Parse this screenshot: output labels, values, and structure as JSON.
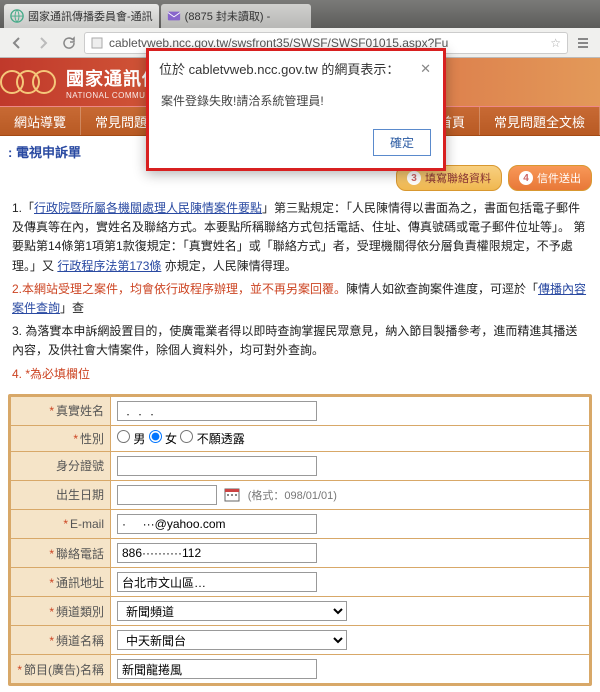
{
  "browser": {
    "tabs": [
      {
        "label": "國家通訊傳播委員會-通訊"
      },
      {
        "label": "(8875 封未讀取) - "
      }
    ],
    "url": "cabletvweb.ncc.gov.tw/swsfront35/SWSF/SWSF01015.aspx?Fu"
  },
  "site": {
    "title_cn": "國家通訊傳",
    "title_en": "NATIONAL COMMUN",
    "nav": [
      "網站導覽",
      "常見問題",
      "首頁",
      "常見問題全文檢"
    ]
  },
  "page": {
    "title": "電視申訴單",
    "steps": [
      {
        "num": "3",
        "label": "填寫聯絡資料"
      },
      {
        "num": "4",
        "label": "信件送出"
      }
    ]
  },
  "instructions": {
    "p1_a": "1.「",
    "p1_link1": "行政院暨所屬各機關處理人民陳情案件要點",
    "p1_b": "」第三點規定：「人民陳情得以書面為之，書面包括電子郵件及傳真等在內，實姓名及聯絡方式。本要點所稱聯絡方式包括電話、住址、傳真號碼或電子郵件位址等」。 第要點第14條第1項第1款復規定：「真實姓名」或「聯絡方式」者，受理機關得依分層負責權限規定，不予處理。」又 ",
    "p1_link2": "行政程序法第173條",
    "p1_c": " 亦規定，人民陳情得理。",
    "p2": "2.本網站受理之案件，均會依行政程序辦理，並不再另案回覆。",
    "p2_b": "陳情人如欲查詢案件進度，可逕於「",
    "p2_link": "傳播內容案件查詢",
    "p2_c": "」查",
    "p3": "3. 為落實本申訴網設置目的，使廣電業者得以即時查詢掌握民眾意見，納入節目製播參考，進而精進其播送內容，及供社會大情案件，除個人資料外，均可對外查詢。",
    "p4": "4. *為必填欄位"
  },
  "form": {
    "labels": {
      "name": "真實姓名",
      "gender": "性別",
      "gender_m": "男",
      "gender_f": "女",
      "gender_x": "不願透露",
      "idnum": "身分證號",
      "birth": "出生日期",
      "birth_hint": "(格式：098/01/01)",
      "email": "E-mail",
      "phone": "聯絡電話",
      "addr": "通訊地址",
      "chtype": "頻道類別",
      "chname": "頻道名稱",
      "prog": "節目(廣告)名稱"
    },
    "values": {
      "name": "﹒﹒﹒",
      "birth": "",
      "email": "·     ···@yahoo.com",
      "phone": "886··········112",
      "addr": "台北市文山區…",
      "chtype": "新聞頻道",
      "chname": "中天新聞台",
      "prog": "新聞龍捲風"
    }
  },
  "modal": {
    "title": "位於 cabletvweb.ncc.gov.tw 的網頁表示：",
    "body": "案件登錄失敗!請洽系統管理員!",
    "ok": "確定"
  }
}
